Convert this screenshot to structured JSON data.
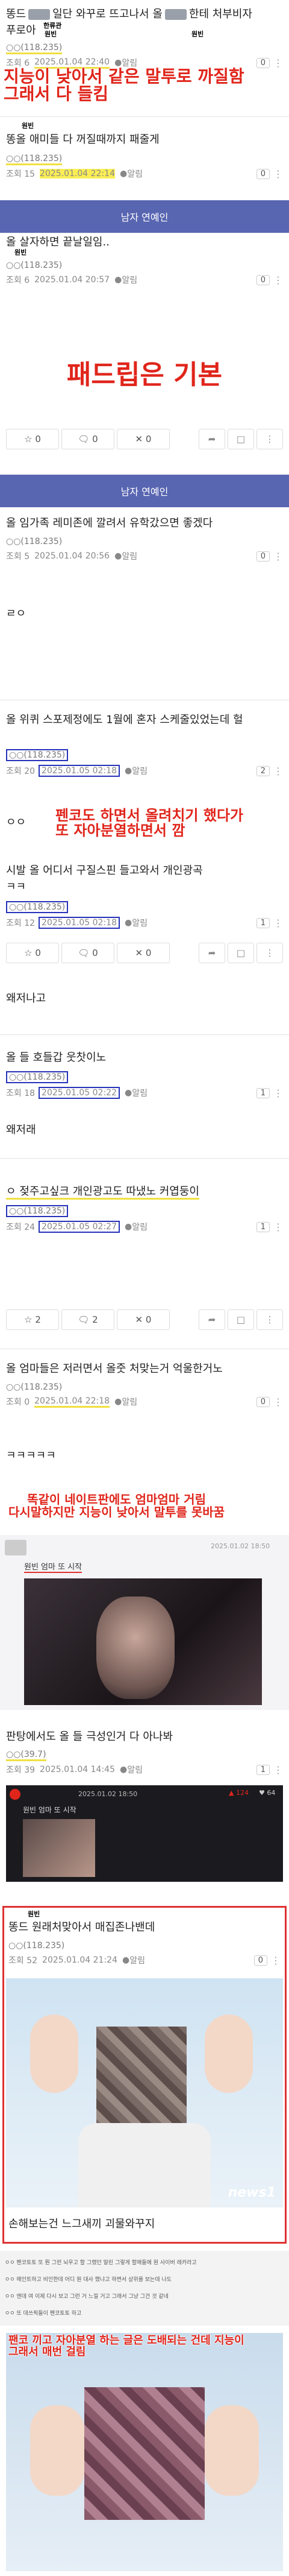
{
  "p1": {
    "text1": "똥드",
    "text2": "일단 와꾸로 뜨고나서 올",
    "text3": "한테 처부비자",
    "text4": "푸로아",
    "sup_a": "한류관",
    "sup_b": "원빈",
    "nick": "○○(118.235)",
    "views": "조회 6",
    "date": "2025.01.04 22:40",
    "alarm": "알림",
    "count": "0",
    "cap": "지능이 낮아서 같은 말투로 까질함\n그래서 다 들킴"
  },
  "p2": {
    "text": "똥올  애미들 다 꺼질때까지 패줄게",
    "sup": "원빈",
    "nick": "○○(118.235)",
    "views": "조회 15",
    "date": "2025.01.04 22:14",
    "alarm": "알림",
    "count": "0"
  },
  "band1": {
    "label": "남자 연예인"
  },
  "p3": {
    "text": "올  살자하면 끝날일임..",
    "sup": "원빈",
    "nick": "○○(118.235)",
    "views": "조회 6",
    "date": "2025.01.04 20:57",
    "alarm": "알림",
    "count": "0"
  },
  "cap_big": "패드립은 기본",
  "a1": {
    "like": "0",
    "reply": "0",
    "dislike": "0"
  },
  "band2": {
    "label": "남자 연예인"
  },
  "p4": {
    "text": "올  임가족 레미존에 깔려서 유학갔으면 좋겠다",
    "nick": "○○(118.235)",
    "views": "조회 5",
    "date": "2025.01.04 20:56",
    "alarm": "알림",
    "count": "0"
  },
  "p5": {
    "text": "ㄹㅇ"
  },
  "p6": {
    "text": "올  위퀴 스포제정에도 1월에 혼자 스케줄있었는데 헐",
    "nick": "○○(118.235)",
    "views": "조회 20",
    "date": "2025.01.05 02:18",
    "alarm": "알림",
    "count": "2"
  },
  "p7": {
    "text": "ㅇㅇ",
    "cap": "펜코도 하면서 올려치기 했다가\n또 자아분열하면서 깜"
  },
  "p8": {
    "text1": "시발 올  어디서 구질스핀 들고와서 개인광곡",
    "text2": "ㅋㅋ",
    "nick": "○○(118.235)",
    "views": "조회 12",
    "date": "2025.01.05 02:18",
    "alarm": "알림",
    "count": "1"
  },
  "a2": {
    "like": "0",
    "reply": "0",
    "dislike": "0"
  },
  "p9": {
    "text": "왜저나고"
  },
  "p10": {
    "text": "올  들 호들갑 웃찻이노",
    "nick": "○○(118.235)",
    "views": "조회 18",
    "date": "2025.01.05 02:22",
    "alarm": "알림",
    "count": "1"
  },
  "p11": {
    "text": "왜저래"
  },
  "p12": {
    "text": "ㅇ 젖주고싶크 개인광고도 따냈노 커엽둥이",
    "nick": "○○(118.235)",
    "views": "조회 24",
    "date": "2025.01.05 02:27",
    "alarm": "알림",
    "count": "1"
  },
  "a3": {
    "like": "2",
    "reply": "2",
    "dislike": "0"
  },
  "p13": {
    "text": "올  엄마들은 저러면서 올줏 처맞는거 억울한거노",
    "nick": "○○(118.235)",
    "views": "조회 0",
    "date": "2025.01.04 22:18",
    "alarm": "알림",
    "count": "0"
  },
  "p14": {
    "text": "ㅋㅋㅋㅋㅋ",
    "cap": "똑같이 네이트판에도 엄마엄마 거림\n다시말하지만 지능이 낮아서 말투를 못바꿈"
  },
  "card1": {
    "title": "원빈 엄마 또 시작",
    "date": "2025.01.02 18:50"
  },
  "p15": {
    "text": "판탕에서도 올  들 극성인거 다 아나봐",
    "nick": "○○(39.7)",
    "views": "조회 39",
    "date": "2025.01.04 14:45",
    "alarm": "알림",
    "count": "1"
  },
  "card2": {
    "title": "원빈 엄마 또 시작",
    "date": "2025.01.02 18:50",
    "views": "124",
    "likes": "64"
  },
  "p16": {
    "text": "똥드  원래처맞아서 매집존나밴데",
    "sup": "원빈",
    "nick": "○○(118.235)",
    "views": "조회 52",
    "date": "2025.01.04 21:24",
    "alarm": "알림",
    "count": "0"
  },
  "p17": {
    "text": "손해보는건 느그새끼 괴물와꾸지",
    "logo": "news1"
  },
  "comments": [
    "ㅇㅇ 팬코토토 또 뭔 그런 뇌우고 할 그랬던 말린 그렇게 할매들에 원 사이버 레카라고",
    "ㅇㅇ 매인트하고 비인한데 어디 원 대사 했냐고 하면서 상위를 보는데 나도",
    "ㅇㅇ 엔데 여 이제 다시 보고 그런 거 느낄 거고 그래서 그냥 그건 것 같네",
    "ㅇㅇ 또 데쓰픽들이 팬코토토 하고"
  ],
  "cap_last": "팬코 끼고 자아분열 하는 글은 도배되는 건데 지능이\n그래서 매번 걸림"
}
